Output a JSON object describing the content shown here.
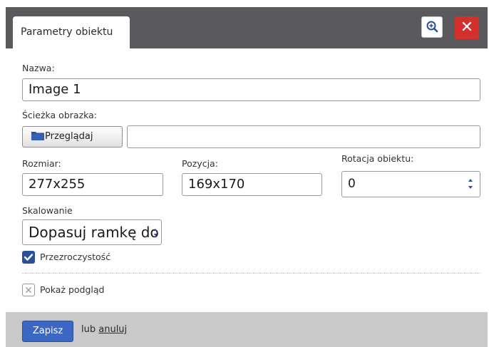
{
  "header": {
    "tab_label": "Parametry obiektu",
    "zoom_icon": "zoom-in-icon",
    "close_label": "✕"
  },
  "form": {
    "name_label": "Nazwa:",
    "name_value": "Image 1",
    "path_label": "Ścieżka obrazka:",
    "browse_label": "Przeglądaj",
    "browse_icon": "folder-icon",
    "path_value": "",
    "size_label": "Rozmiar:",
    "size_value": "277x255",
    "position_label": "Pozycja:",
    "position_value": "169x170",
    "rotation_label": "Rotacja obiektu:",
    "rotation_value": "0",
    "scaling_label": "Skalowanie",
    "scaling_value": "Dopasuj ramkę do z",
    "transparency_label": "Przezroczystość",
    "transparency_checked": true,
    "preview_label": "Pokaż podgląd",
    "preview_checked": false
  },
  "footer": {
    "save_label": "Zapisz",
    "or_text": "lub",
    "cancel_label": "anuluj"
  },
  "colors": {
    "header_bg": "#5a5a5e",
    "close_red": "#d3302b",
    "save_blue": "#3c68c4",
    "checkbox_blue": "#2b4f98",
    "footer_bg": "#c9c9ca"
  }
}
